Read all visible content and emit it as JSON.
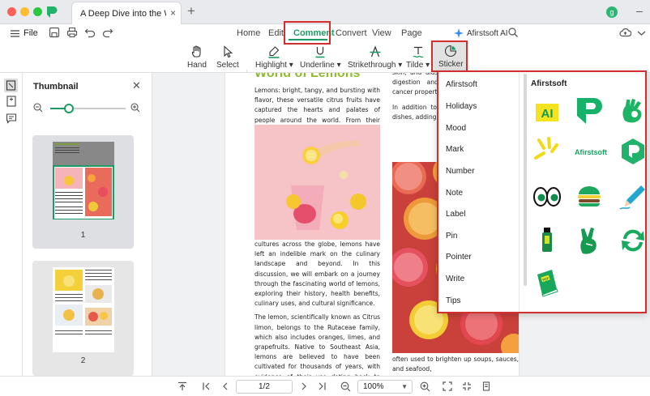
{
  "window": {
    "tab_title": "A Deep Dive into the W... *",
    "tab_close": "×",
    "new_tab": "+",
    "avatar_letter": "g"
  },
  "menu": {
    "file": "File",
    "nav": [
      "Home",
      "Edit",
      "Comment",
      "Convert",
      "View",
      "Page"
    ],
    "active": "Comment",
    "ai_label": "Afirstsoft AI"
  },
  "tools": [
    {
      "label": "Hand",
      "icon": "hand-icon"
    },
    {
      "label": "Select",
      "icon": "cursor-icon"
    },
    {
      "label": "Highlight ▾",
      "icon": "highlight-icon"
    },
    {
      "label": "Underline ▾",
      "icon": "underline-icon"
    },
    {
      "label": "Strikethrough ▾",
      "icon": "strikethrough-icon"
    },
    {
      "label": "Tilde ▾",
      "icon": "tilde-icon"
    },
    {
      "label": "Sticker",
      "icon": "sticker-icon"
    }
  ],
  "thumbnail": {
    "title": "Thumbnail",
    "zoom_level": 0.25,
    "pages": [
      "1",
      "2"
    ],
    "selected_page": 1
  },
  "document": {
    "heading": "World of Lemons",
    "col1_p1": "Lemons: bright, tangy, and bursting with flavor, these versatile citrus fruits have captured the hearts and palates of people around the world. From their origins in ancient Asia to their widespread use in cuisines and",
    "col1_p2": "cultures across the globe, lemons have left an indelible mark on the culinary landscape and beyond. In this discussion, we will embark on a journey through the fascinating world of lemons, exploring their history, health benefits, culinary uses, and cultural significance.",
    "col1_p3": "The lemon, scientifically known as Citrus limon, belongs to the Rutaceae family, which also includes oranges, limes, and grapefruits. Native to Southeast Asia, lemons are believed to have been cultivated for thousands of years, with evidence of their use dating back to ancient China and India. From there, lemons spread to the Mediterranean region, where they were",
    "col2_p1": "skin, and aids in the contain citric aci digestion and pre flavonoids, which cancer properties.",
    "col2_p2": "In addition to their lemons can be us dishes, adding bri the flavor profile. juice",
    "col2_p3": "often used to brighten up soups, sauces, and seafood,"
  },
  "sticker_panel": {
    "categories": [
      "Afirstsoft",
      "Holidays",
      "Mood",
      "Mark",
      "Number",
      "Note",
      "Label",
      "Pin",
      "Pointer",
      "Write",
      "Tips"
    ],
    "selected_category": "Afirstsoft",
    "title": "Afirstsoft",
    "stickers": [
      {
        "name": "ai-badge-sticker",
        "text": "AI"
      },
      {
        "name": "afirstsoft-logo-sticker"
      },
      {
        "name": "ok-hand-sticker"
      },
      {
        "name": "sparkle-lines-sticker"
      },
      {
        "name": "afirstsoft-wordmark-sticker",
        "text": "Afirstsoft"
      },
      {
        "name": "hexagon-logo-sticker"
      },
      {
        "name": "eyes-sticker"
      },
      {
        "name": "burger-sticker"
      },
      {
        "name": "pen-sticker"
      },
      {
        "name": "highlighter-sticker"
      },
      {
        "name": "victory-hand-sticker"
      },
      {
        "name": "refresh-arrows-sticker"
      },
      {
        "name": "book-sticker",
        "text": "PDF"
      }
    ]
  },
  "bottom_bar": {
    "page_indicator": "1/2",
    "zoom": "100%"
  },
  "colors": {
    "brand_green": "#1c9c64",
    "highlight_red": "#d32f2f",
    "lemon_heading": "#8dbb2f"
  }
}
